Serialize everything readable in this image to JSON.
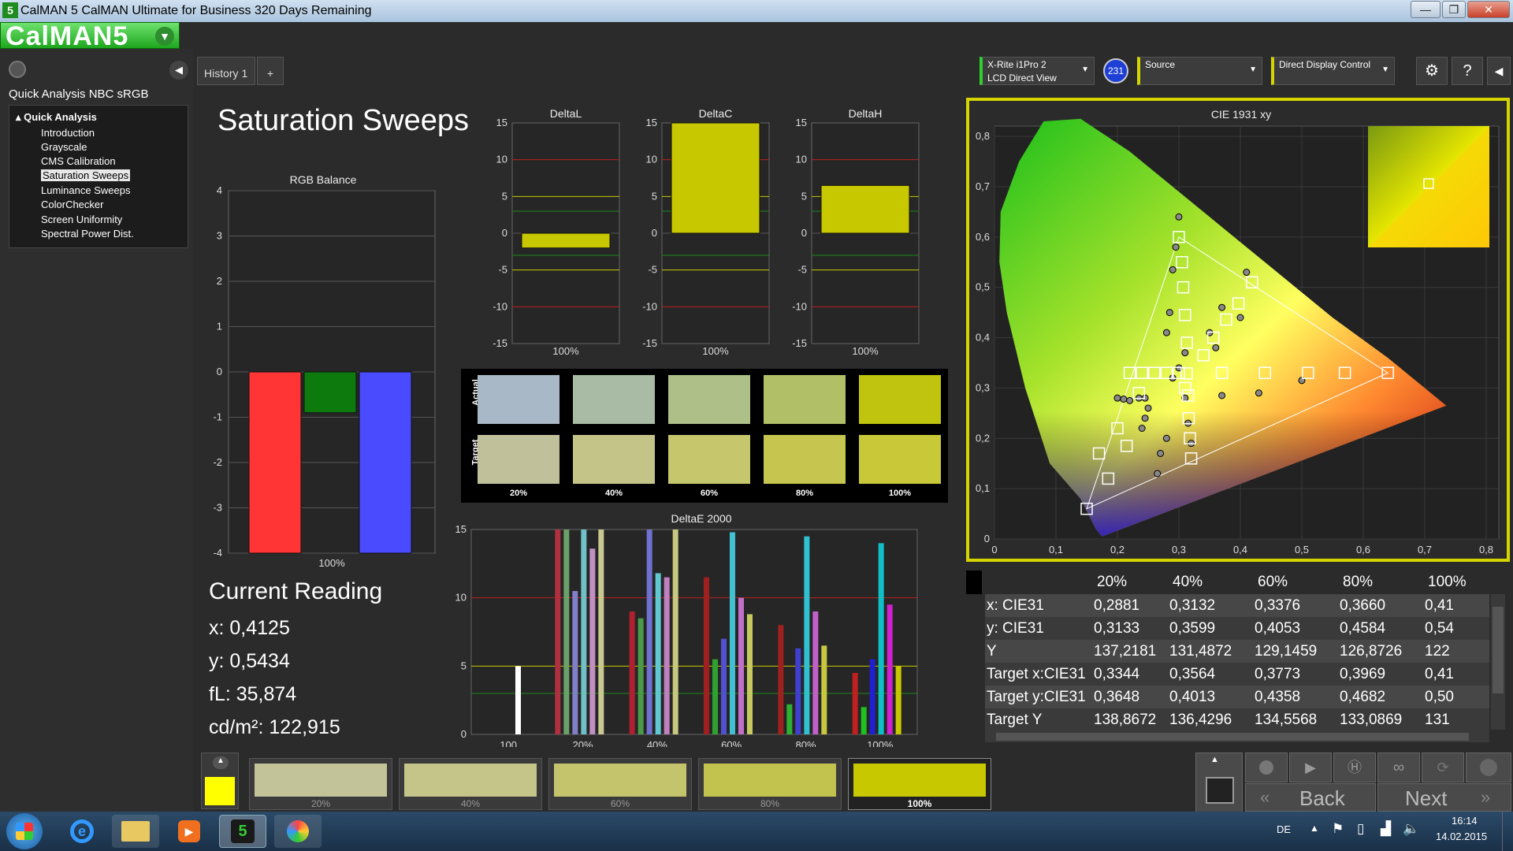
{
  "window": {
    "title": "CalMAN 5 CalMAN Ultimate for Business 320 Days Remaining",
    "app_icon_label": "5",
    "minimize": "—",
    "maximize": "❐",
    "close": "✕"
  },
  "logo": {
    "text": "CalMAN5"
  },
  "sidebar": {
    "title": "Quick Analysis NBC sRGB",
    "root": "Quick Analysis",
    "items": [
      {
        "label": "Introduction"
      },
      {
        "label": "Grayscale"
      },
      {
        "label": "CMS Calibration"
      },
      {
        "label": "Saturation Sweeps"
      },
      {
        "label": "Luminance Sweeps"
      },
      {
        "label": "ColorChecker"
      },
      {
        "label": "Screen Uniformity"
      },
      {
        "label": "Spectral Power Dist."
      }
    ],
    "selected_index": 3
  },
  "tabs": [
    {
      "label": "History 1"
    },
    {
      "label": "+"
    }
  ],
  "devices": {
    "meter_line1": "X-Rite i1Pro 2",
    "meter_line2": "LCD Direct View",
    "badge": "231",
    "source": "Source",
    "display": "Direct Display Control"
  },
  "page_title": "Saturation Sweeps",
  "rgb_balance": {
    "title": "RGB Balance",
    "xlabel": "100%",
    "yticks": [
      "4",
      "3",
      "2",
      "1",
      "0",
      "-1",
      "-2",
      "-3",
      "-4"
    ],
    "values": {
      "r": -4,
      "g": -0.9,
      "b": -4
    },
    "colors": {
      "r": "#ff3434",
      "g": "#0c7a0c",
      "b": "#4a4aff"
    }
  },
  "delta_charts": [
    {
      "title": "DeltaL",
      "xlabel": "100%",
      "value": -2,
      "yticks": [
        "15",
        "10",
        "5",
        "0",
        "-5",
        "-10",
        "-15"
      ]
    },
    {
      "title": "DeltaC",
      "xlabel": "100%",
      "value": 15,
      "yticks": [
        "15",
        "10",
        "5",
        "0",
        "-5",
        "-10",
        "-15"
      ]
    },
    {
      "title": "DeltaH",
      "xlabel": "100%",
      "value": 6.5,
      "yticks": [
        "15",
        "10",
        "5",
        "0",
        "-5",
        "-10",
        "-15"
      ]
    }
  ],
  "swatches": {
    "actual_label": "Actual",
    "target_label": "Target",
    "items": [
      {
        "label": "20%",
        "actual": "#a9b8c6",
        "target": "#c0c09b"
      },
      {
        "label": "40%",
        "actual": "#a9bba4",
        "target": "#c4c489"
      },
      {
        "label": "60%",
        "actual": "#aebf88",
        "target": "#c6c66c"
      },
      {
        "label": "80%",
        "actual": "#b1c066",
        "target": "#c5c54f"
      },
      {
        "label": "100%",
        "actual": "#c0c40f",
        "target": "#c8c838"
      }
    ]
  },
  "deltae": {
    "title": "DeltaE 2000",
    "yticks": [
      "15",
      "10",
      "5",
      "0"
    ],
    "categories": [
      "100",
      "20%",
      "40%",
      "60%",
      "80%",
      "100%"
    ]
  },
  "chart_data": [
    {
      "type": "bar",
      "title": "RGB Balance",
      "categories": [
        "100%"
      ],
      "series": [
        {
          "values": [
            -4
          ]
        },
        {
          "values": [
            -0.9
          ]
        },
        {
          "values": [
            -4
          ]
        }
      ],
      "ylim": [
        -4,
        4
      ]
    },
    {
      "type": "bar",
      "title": "DeltaE 2000",
      "categories": [
        "100",
        "20%",
        "40%",
        "60%",
        "80%",
        "100%"
      ],
      "series": [
        {
          "values": [
            null,
            15,
            9,
            11.5,
            8,
            4.5
          ]
        },
        {
          "values": [
            null,
            15,
            8.5,
            5.5,
            2.2,
            2
          ]
        },
        {
          "values": [
            null,
            10.5,
            15,
            7,
            6.3,
            5.5
          ]
        },
        {
          "values": [
            null,
            15,
            11.8,
            14.8,
            14.5,
            14
          ]
        },
        {
          "values": [
            5,
            13.6,
            11.5,
            10,
            9,
            9.5
          ]
        },
        {
          "values": [
            null,
            15,
            15,
            8.8,
            6.5,
            5
          ]
        }
      ],
      "ylim": [
        0,
        15
      ]
    },
    {
      "type": "scatter",
      "title": "CIE 1931 xy",
      "xticks": [
        "0",
        "0,1",
        "0,2",
        "0,3",
        "0,4",
        "0,5",
        "0,6",
        "0,7",
        "0,8"
      ],
      "yticks": [
        "0",
        "0,1",
        "0,2",
        "0,3",
        "0,4",
        "0,5",
        "0,6",
        "0,7",
        "0,8"
      ],
      "targets": [
        [
          0.3,
          0.6
        ],
        [
          0.305,
          0.55
        ],
        [
          0.307,
          0.5
        ],
        [
          0.31,
          0.445
        ],
        [
          0.313,
          0.39
        ],
        [
          0.3127,
          0.329
        ],
        [
          0.22,
          0.33
        ],
        [
          0.24,
          0.33
        ],
        [
          0.26,
          0.33
        ],
        [
          0.28,
          0.33
        ],
        [
          0.3,
          0.33
        ],
        [
          0.37,
          0.33
        ],
        [
          0.44,
          0.33
        ],
        [
          0.51,
          0.33
        ],
        [
          0.57,
          0.33
        ],
        [
          0.64,
          0.33
        ],
        [
          0.2,
          0.22
        ],
        [
          0.215,
          0.185
        ],
        [
          0.235,
          0.29
        ],
        [
          0.315,
          0.285
        ],
        [
          0.316,
          0.24
        ],
        [
          0.318,
          0.2
        ],
        [
          0.32,
          0.16
        ],
        [
          0.17,
          0.17
        ],
        [
          0.15,
          0.06
        ],
        [
          0.185,
          0.12
        ],
        [
          0.31,
          0.3
        ],
        [
          0.34,
          0.365
        ],
        [
          0.356,
          0.4
        ],
        [
          0.377,
          0.436
        ],
        [
          0.397,
          0.468
        ],
        [
          0.419,
          0.51
        ]
      ],
      "actuals": [
        [
          0.3,
          0.64
        ],
        [
          0.295,
          0.58
        ],
        [
          0.29,
          0.535
        ],
        [
          0.285,
          0.45
        ],
        [
          0.28,
          0.41
        ],
        [
          0.31,
          0.37
        ],
        [
          0.35,
          0.41
        ],
        [
          0.37,
          0.46
        ],
        [
          0.41,
          0.53
        ],
        [
          0.3,
          0.34
        ],
        [
          0.29,
          0.32
        ],
        [
          0.2,
          0.28
        ],
        [
          0.21,
          0.278
        ],
        [
          0.22,
          0.275
        ],
        [
          0.235,
          0.28
        ],
        [
          0.245,
          0.28
        ],
        [
          0.25,
          0.26
        ],
        [
          0.245,
          0.24
        ],
        [
          0.24,
          0.22
        ],
        [
          0.28,
          0.2
        ],
        [
          0.27,
          0.17
        ],
        [
          0.265,
          0.13
        ],
        [
          0.31,
          0.28
        ],
        [
          0.315,
          0.23
        ],
        [
          0.32,
          0.19
        ],
        [
          0.37,
          0.285
        ],
        [
          0.43,
          0.29
        ],
        [
          0.5,
          0.315
        ],
        [
          0.36,
          0.38
        ],
        [
          0.4,
          0.44
        ]
      ]
    }
  ],
  "reading": {
    "title": "Current Reading",
    "x": "x: 0,4125",
    "y": "y: 0,5434",
    "fl": "fL: 35,874",
    "cdm2": "cd/m²: 122,915"
  },
  "cie": {
    "title": "CIE 1931 xy"
  },
  "table": {
    "headers": [
      "20%",
      "40%",
      "60%",
      "80%",
      "100%"
    ],
    "rows": [
      {
        "label": "x: CIE31",
        "values": [
          "0,2881",
          "0,3132",
          "0,3376",
          "0,3660",
          "0,41"
        ]
      },
      {
        "label": "y: CIE31",
        "values": [
          "0,3133",
          "0,3599",
          "0,4053",
          "0,4584",
          "0,54"
        ]
      },
      {
        "label": "Y",
        "values": [
          "137,2181",
          "131,4872",
          "129,1459",
          "126,8726",
          "122"
        ]
      },
      {
        "label": "Target x:CIE31",
        "values": [
          "0,3344",
          "0,3564",
          "0,3773",
          "0,3969",
          "0,41"
        ]
      },
      {
        "label": "Target y:CIE31",
        "values": [
          "0,3648",
          "0,4013",
          "0,4358",
          "0,4682",
          "0,50"
        ]
      },
      {
        "label": "Target Y",
        "values": [
          "138,8672",
          "136,4296",
          "134,5568",
          "133,0869",
          "131"
        ]
      }
    ]
  },
  "bottom": {
    "swatches": [
      {
        "label": "20%",
        "color": "#c3c399"
      },
      {
        "label": "40%",
        "color": "#c5c58a"
      },
      {
        "label": "60%",
        "color": "#c4c46c"
      },
      {
        "label": "80%",
        "color": "#c2c24e"
      },
      {
        "label": "100%",
        "color": "#c8c800"
      }
    ],
    "current_color": "#ffff00",
    "back": "Back",
    "next": "Next"
  },
  "taskbar": {
    "lang": "DE",
    "time": "16:14",
    "date": "14.02.2015"
  }
}
